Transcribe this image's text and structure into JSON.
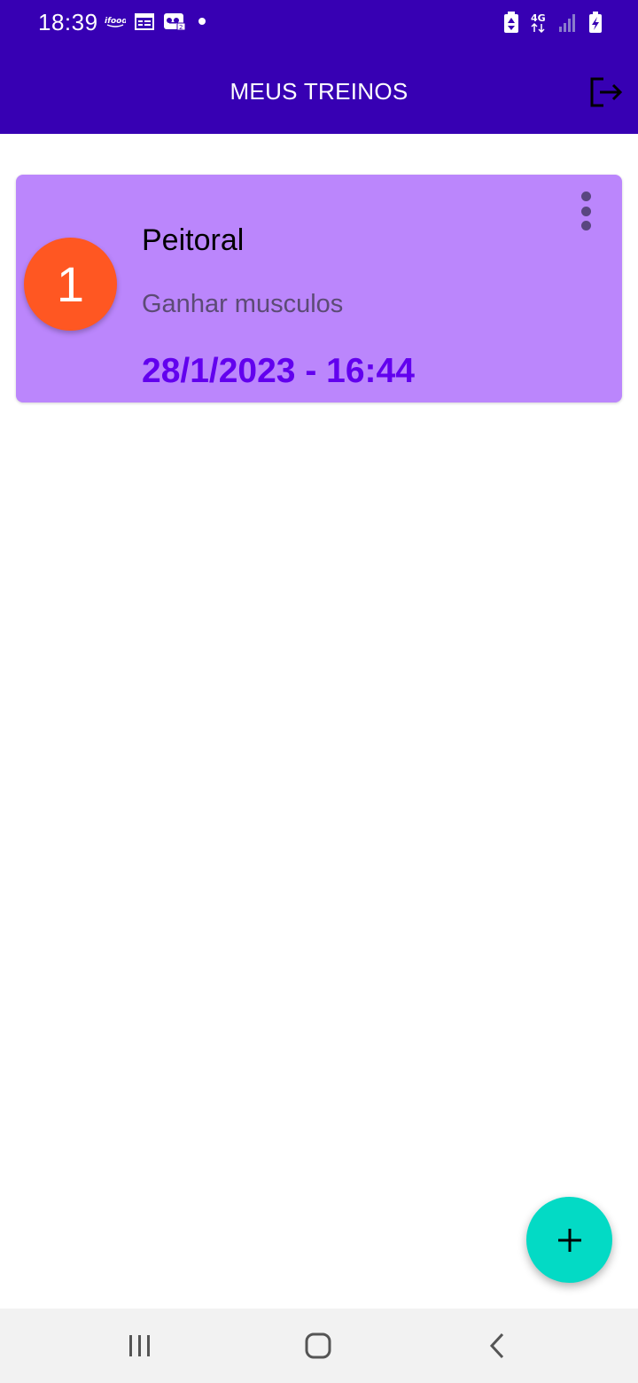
{
  "status_bar": {
    "time": "18:39",
    "left_icons": [
      "ifood-notification-icon",
      "calendar-notification-icon",
      "voicemail-notification-icon",
      "more-notifications-dot-icon"
    ],
    "right_icons": [
      "battery-saver-icon",
      "network-4g-icon",
      "signal-strength-icon",
      "battery-charging-icon"
    ],
    "network_label": "4G"
  },
  "app_bar": {
    "title": "MEUS TREINOS",
    "logout_icon": "logout-icon"
  },
  "colors": {
    "primary": "#3700B3",
    "card_background": "#BB86FC",
    "avatar": "#FF5722",
    "date_text": "#6200EE",
    "fab": "#03DAC5"
  },
  "workouts": [
    {
      "number": "1",
      "name": "Peitoral",
      "goal": "Ganhar musculos",
      "datetime": "28/1/2023 - 16:44"
    }
  ],
  "fab": {
    "icon": "plus-icon"
  },
  "nav_bar": {
    "buttons": [
      "recent-apps-icon",
      "home-icon",
      "back-icon"
    ]
  }
}
